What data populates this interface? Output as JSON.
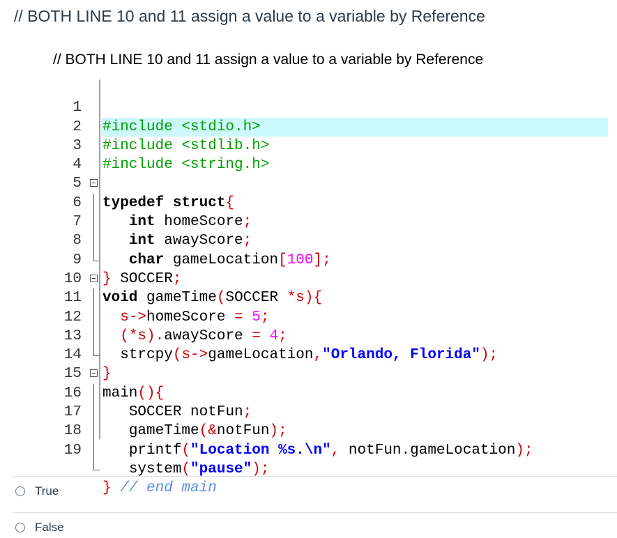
{
  "question": {
    "text": "// BOTH LINE 10 and 11 assign a value to a variable by Reference",
    "image_caption": "// BOTH LINE 10 and 11 assign a value to a variable by Reference"
  },
  "code": {
    "line_numbers": [
      "1",
      "2",
      "3",
      "4",
      "5",
      "6",
      "7",
      "8",
      "9",
      "10",
      "11",
      "12",
      "13",
      "14",
      "15",
      "16",
      "17",
      "18",
      "19"
    ],
    "l1": "#include <stdio.h>",
    "l2": "#include <stdlib.h>",
    "l3": "#include <string.h>",
    "l4_kw1": "typedef",
    "l4_kw2": "struct",
    "l4_brace": "{",
    "l5_kw": "int",
    "l5_id": "homeScore",
    "l5_semi": ";",
    "l6_kw": "int",
    "l6_id": "awayScore",
    "l6_semi": ";",
    "l7_kw": "char",
    "l7_id": "gameLocation",
    "l7_b1": "[",
    "l7_num": "100",
    "l7_b2": "];",
    "l8_brace": "}",
    "l8_id": "SOCCER",
    "l8_semi": ";",
    "l9_kw": "void",
    "l9_id": "gameTime",
    "l9_p1": "(",
    "l9_type": "SOCCER",
    "l9_ptr": "*s)",
    "l9_brace": "{",
    "l10_a": "s->",
    "l10_id": "homeScore",
    "l10_eq": "=",
    "l10_num": "5",
    "l10_semi": ";",
    "l11_a": "(*s).",
    "l11_id": "awayScore",
    "l11_eq": "=",
    "l11_num": "4",
    "l11_semi": ";",
    "l12_id": "strcpy",
    "l12_p1": "(s->",
    "l12_id2": "gameLocation",
    "l12_comma": ",",
    "l12_str": "\"Orlando, Florida\"",
    "l12_end": ");",
    "l13_brace": "}",
    "l14_id": "main",
    "l14_p": "()",
    "l14_brace": "{",
    "l15_id": "SOCCER",
    "l15_id2": "notFun",
    "l15_semi": ";",
    "l16_id": "gameTime",
    "l16_p1": "(&",
    "l16_id2": "notFun",
    "l16_end": ");",
    "l17_id": "printf",
    "l17_p1": "(",
    "l17_str": "\"Location %s.\\n\"",
    "l17_comma": ",",
    "l17_id2": "notFun.gameLocation",
    "l17_end": ");",
    "l18_id": "system",
    "l18_p1": "(",
    "l18_str": "\"pause\"",
    "l18_end": ");",
    "l19_brace": "}",
    "l19_cmt": "// end main"
  },
  "answers": [
    {
      "label": "True"
    },
    {
      "label": "False"
    }
  ]
}
